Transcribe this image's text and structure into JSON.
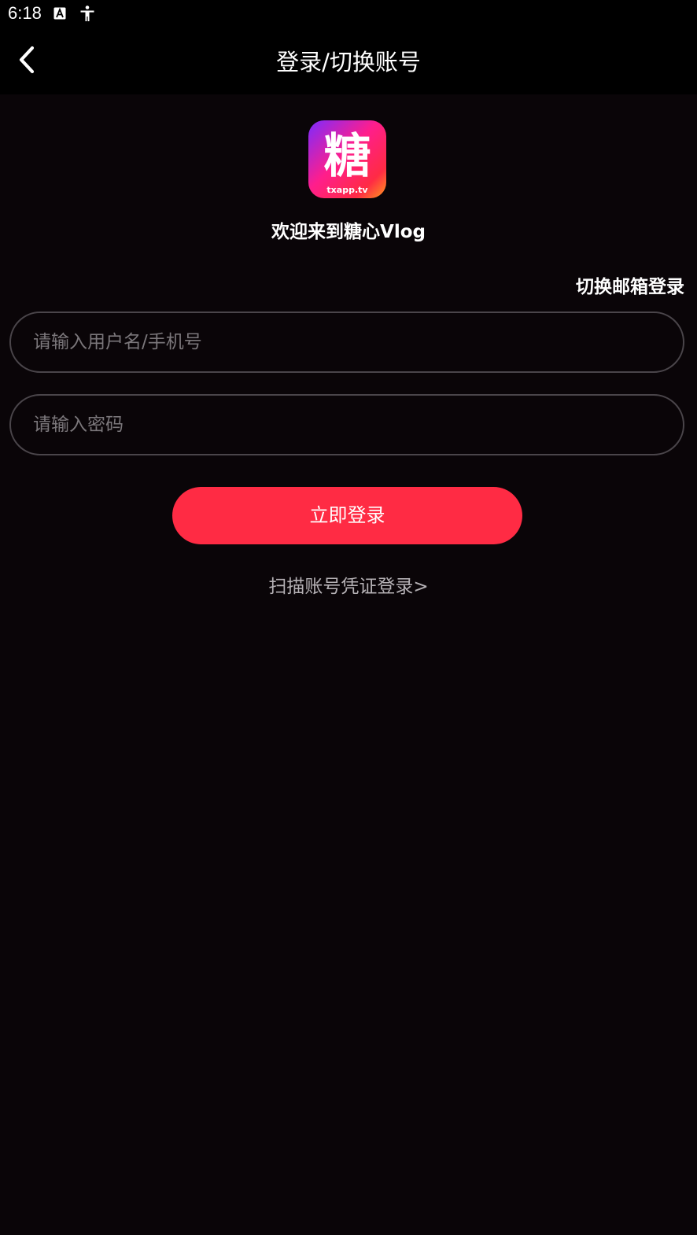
{
  "status_bar": {
    "time": "6:18",
    "icons": [
      "a-box-icon",
      "accessibility-icon"
    ]
  },
  "app_bar": {
    "back_icon": "chevron-left-icon",
    "title": "登录/切换账号"
  },
  "logo": {
    "glyph": "糖",
    "caption": "txapp.tv"
  },
  "welcome": "欢迎来到糖心Vlog",
  "switch_email_label": "切换邮箱登录",
  "username": {
    "value": "",
    "placeholder": "请输入用户名/手机号"
  },
  "password": {
    "value": "",
    "placeholder": "请输入密码"
  },
  "login_button_label": "立即登录",
  "scan_link_label": "扫描账号凭证登录>",
  "colors": {
    "accent": "#ff2b44",
    "background": "#0a0508",
    "header": "#000000",
    "field_border": "#4a454a",
    "placeholder": "#7b777b",
    "link": "#b5b1b5"
  }
}
